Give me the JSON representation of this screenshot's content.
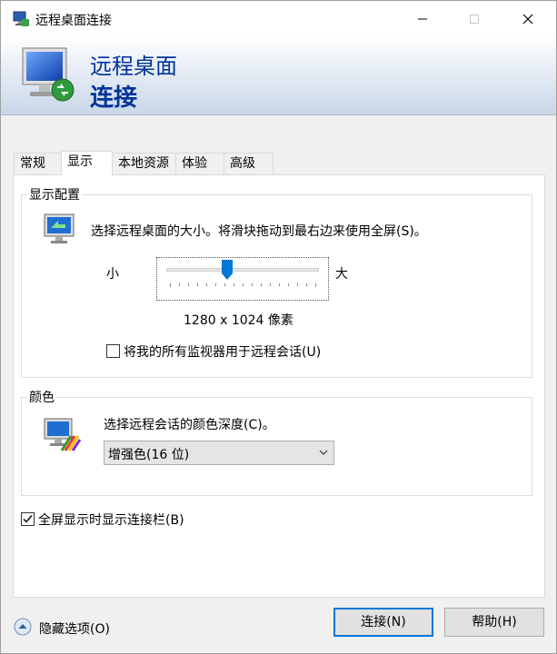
{
  "window": {
    "title": "远程桌面连接",
    "controls": {
      "minimize": "minimize-icon",
      "maximize": "maximize-icon",
      "close": "close-icon"
    }
  },
  "banner": {
    "line1": "远程桌面",
    "line2": "连接"
  },
  "tabs": [
    {
      "label": "常规",
      "active": false
    },
    {
      "label": "显示",
      "active": true
    },
    {
      "label": "本地资源",
      "active": false
    },
    {
      "label": "体验",
      "active": false
    },
    {
      "label": "高级",
      "active": false
    }
  ],
  "display_config": {
    "legend": "显示配置",
    "description": "选择远程桌面的大小。将滑块拖动到最右边来使用全屏(S)。",
    "slider": {
      "min_label": "小",
      "max_label": "大",
      "value_fraction": 0.4
    },
    "resolution": "1280 x 1024 像素",
    "use_all_monitors": {
      "label": "将我的所有监视器用于远程会话(U)",
      "checked": false
    }
  },
  "colors": {
    "legend": "颜色",
    "description": "选择远程会话的颜色深度(C)。",
    "depth_select": {
      "value": "增强色(16 位)"
    }
  },
  "show_connection_bar": {
    "label": "全屏显示时显示连接栏(B)",
    "checked": true
  },
  "footer": {
    "hide_options": "隐藏选项(O)",
    "connect_button": "连接(N)",
    "help_button": "帮助(H)"
  },
  "theme": {
    "accent": "#0078d7",
    "banner_text": "#003399"
  }
}
